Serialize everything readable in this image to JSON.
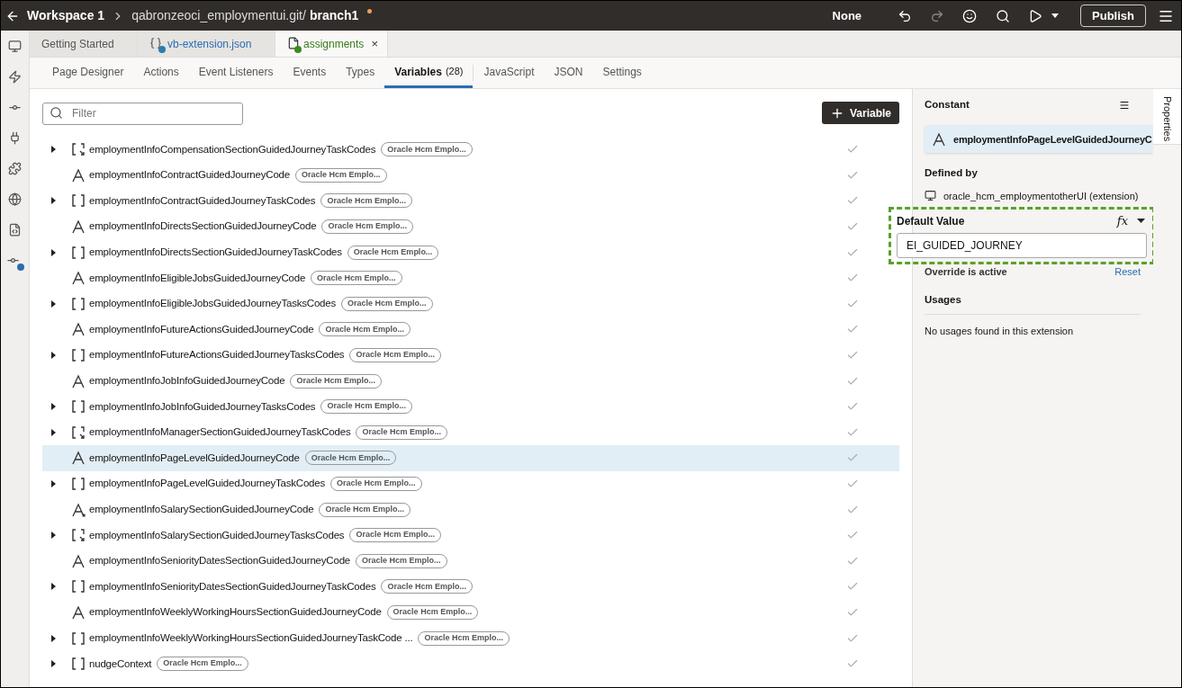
{
  "header": {
    "workspace": "Workspace 1",
    "repo": "qabronzeoci_employmentui.git/",
    "branch": "branch1",
    "modified": true,
    "mode": "None",
    "publish": "Publish"
  },
  "file_tabs": [
    {
      "label": "Getting Started",
      "kind": "plain",
      "selected": false
    },
    {
      "label": "vb-extension.json",
      "kind": "json",
      "selected": false
    },
    {
      "label": "assignments",
      "kind": "page",
      "selected": true,
      "close": "×"
    }
  ],
  "sub_tabs": [
    {
      "label": "Page Designer",
      "selected": false
    },
    {
      "label": "Actions",
      "selected": false
    },
    {
      "label": "Event Listeners",
      "selected": false
    },
    {
      "label": "Events",
      "selected": false
    },
    {
      "label": "Types",
      "selected": false
    },
    {
      "label": "Variables",
      "count": "(28)",
      "selected": true
    },
    {
      "label": "JavaScript",
      "selected": false
    },
    {
      "label": "JSON",
      "selected": false
    },
    {
      "label": "Settings",
      "selected": false
    }
  ],
  "filter": {
    "placeholder": "Filter"
  },
  "add_button": "Variable",
  "variables": [
    {
      "name": "employmentInfoCompensationSectionGuidedJourneyTaskCodes",
      "kind": "array",
      "overridden": true,
      "selected": false,
      "tag": "Oracle Hcm Emplo..."
    },
    {
      "name": "employmentInfoContractGuidedJourneyCode",
      "kind": "string",
      "overridden": false,
      "selected": false,
      "tag": "Oracle Hcm Emplo..."
    },
    {
      "name": "employmentInfoContractGuidedJourneyTaskCodes",
      "kind": "array",
      "overridden": false,
      "selected": false,
      "tag": "Oracle Hcm Emplo..."
    },
    {
      "name": "employmentInfoDirectsSectionGuidedJourneyCode",
      "kind": "string",
      "overridden": false,
      "selected": false,
      "tag": "Oracle Hcm Emplo..."
    },
    {
      "name": "employmentInfoDirectsSectionGuidedJourneyTaskCodes",
      "kind": "array",
      "overridden": false,
      "selected": false,
      "tag": "Oracle Hcm Emplo..."
    },
    {
      "name": "employmentInfoEligibleJobsGuidedJourneyCode",
      "kind": "string",
      "overridden": false,
      "selected": false,
      "tag": "Oracle Hcm Emplo..."
    },
    {
      "name": "employmentInfoEligibleJobsGuidedJourneyTasksCodes",
      "kind": "array",
      "overridden": false,
      "selected": false,
      "tag": "Oracle Hcm Emplo..."
    },
    {
      "name": "employmentInfoFutureActionsGuidedJourneyCode",
      "kind": "string",
      "overridden": false,
      "selected": false,
      "tag": "Oracle Hcm Emplo..."
    },
    {
      "name": "employmentInfoFutureActionsGuidedJourneyTasksCodes",
      "kind": "array",
      "overridden": false,
      "selected": false,
      "tag": "Oracle Hcm Emplo..."
    },
    {
      "name": "employmentInfoJobInfoGuidedJourneyCode",
      "kind": "string",
      "overridden": false,
      "selected": false,
      "tag": "Oracle Hcm Emplo..."
    },
    {
      "name": "employmentInfoJobInfoGuidedJourneyTasksCodes",
      "kind": "array",
      "overridden": false,
      "selected": false,
      "tag": "Oracle Hcm Emplo..."
    },
    {
      "name": "employmentInfoManagerSectionGuidedJourneyTaskCodes",
      "kind": "array",
      "overridden": true,
      "selected": false,
      "tag": "Oracle Hcm Emplo..."
    },
    {
      "name": "employmentInfoPageLevelGuidedJourneyCode",
      "kind": "string",
      "overridden": false,
      "selected": true,
      "tag": "Oracle Hcm Emplo..."
    },
    {
      "name": "employmentInfoPageLevelGuidedJourneyTaskCodes",
      "kind": "array",
      "overridden": false,
      "selected": false,
      "tag": "Oracle Hcm Emplo..."
    },
    {
      "name": "employmentInfoSalarySectionGuidedJourneyCode",
      "kind": "string",
      "overridden": true,
      "selected": false,
      "tag": "Oracle Hcm Emplo..."
    },
    {
      "name": "employmentInfoSalarySectionGuidedJourneyTasksCodes",
      "kind": "array",
      "overridden": true,
      "selected": false,
      "tag": "Oracle Hcm Emplo..."
    },
    {
      "name": "employmentInfoSeniorityDatesSectionGuidedJourneyCode",
      "kind": "string",
      "overridden": false,
      "selected": false,
      "tag": "Oracle Hcm Emplo..."
    },
    {
      "name": "employmentInfoSeniorityDatesSectionGuidedJourneyTaskCodes",
      "kind": "array",
      "overridden": false,
      "selected": false,
      "tag": "Oracle Hcm Emplo..."
    },
    {
      "name": "employmentInfoWeeklyWorkingHoursSectionGuidedJourneyCode",
      "kind": "string",
      "overridden": false,
      "selected": false,
      "tag": "Oracle Hcm Emplo..."
    },
    {
      "name": "employmentInfoWeeklyWorkingHoursSectionGuidedJourneyTaskCode ...",
      "kind": "array",
      "overridden": false,
      "selected": false,
      "tag": "Oracle Hcm Emplo..."
    },
    {
      "name": "nudgeContext",
      "kind": "array",
      "overridden": false,
      "selected": false,
      "tag": "Oracle Hcm Emplo..."
    }
  ],
  "properties": {
    "type_label": "Constant",
    "variable": "employmentInfoPageLevelGuidedJourneyC",
    "defined_by_label": "Defined by",
    "defined_by": "oracle_hcm_employmentotherUI (extension)",
    "default_value_label": "Default Value",
    "fx": "fx",
    "default_value": "EI_GUIDED_JOURNEY",
    "override": "Override is active",
    "reset": "Reset",
    "usages_label": "Usages",
    "usages": "No usages found in this extension",
    "side_tab": "Properties"
  }
}
